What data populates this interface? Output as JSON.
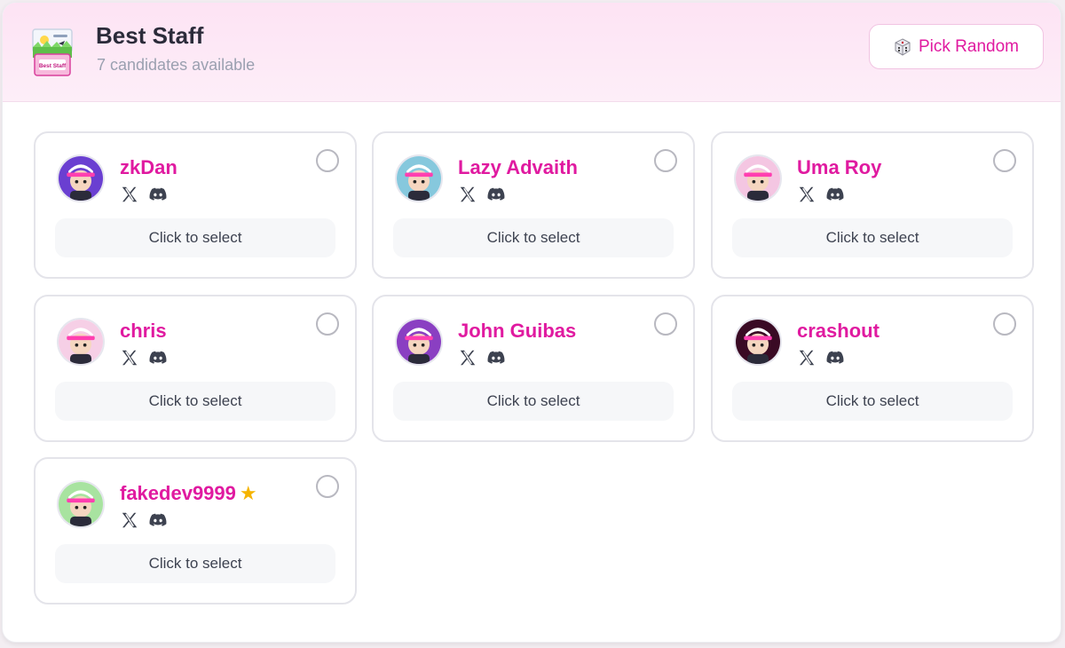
{
  "header": {
    "title": "Best Staff",
    "subtitle": "7 candidates available",
    "logo_text": "Best Staff",
    "logo_icon": "ballot-box-icon",
    "pick_random_label": "Pick Random",
    "pick_random_icon": "dice-icon"
  },
  "colors": {
    "accent": "#e01aa0",
    "header_bg": "#fde3f4",
    "card_border": "#e4e4ea",
    "select_bg": "#f6f7f9"
  },
  "candidates": [
    {
      "name": "zkDan",
      "select_label": "Click to select",
      "avatar_color": "#6a3fd1",
      "starred": false,
      "socials": [
        "x-icon",
        "discord-icon"
      ]
    },
    {
      "name": "Lazy Advaith",
      "select_label": "Click to select",
      "avatar_color": "#86c8dd",
      "starred": false,
      "socials": [
        "x-icon",
        "discord-icon"
      ]
    },
    {
      "name": "Uma Roy",
      "select_label": "Click to select",
      "avatar_color": "#f4c6e2",
      "starred": false,
      "socials": [
        "x-icon",
        "discord-icon"
      ]
    },
    {
      "name": "chris",
      "select_label": "Click to select",
      "avatar_color": "#f6cfe6",
      "starred": false,
      "socials": [
        "x-icon",
        "discord-icon"
      ]
    },
    {
      "name": "John Guibas",
      "select_label": "Click to select",
      "avatar_color": "#8a3fc2",
      "starred": false,
      "socials": [
        "x-icon",
        "discord-icon"
      ]
    },
    {
      "name": "crashout",
      "select_label": "Click to select",
      "avatar_color": "#3a0a24",
      "starred": false,
      "socials": [
        "x-icon",
        "discord-icon"
      ]
    },
    {
      "name": "fakedev9999",
      "select_label": "Click to select",
      "avatar_color": "#a8e3a0",
      "starred": true,
      "socials": [
        "x-icon",
        "discord-icon"
      ]
    }
  ]
}
